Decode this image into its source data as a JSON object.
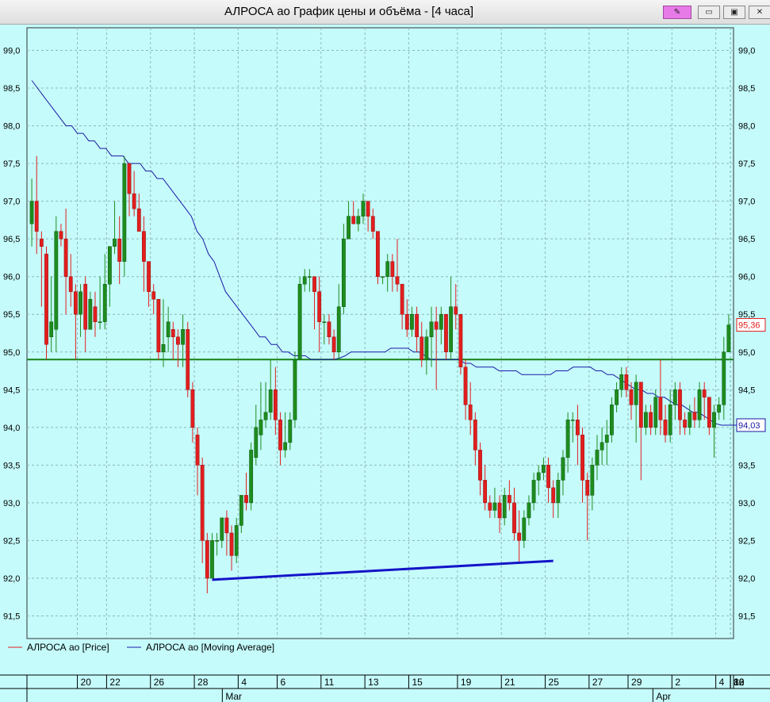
{
  "window": {
    "title": "АЛРОСА ао График цены и объёма - [4 часа]",
    "icons": {
      "pin": "pin-icon",
      "minimize": "minimize-icon",
      "restore": "restore-icon",
      "close": "close-icon"
    }
  },
  "chart_data": {
    "type": "candlestick",
    "title": "АЛРОСА ао График цены и объёма - [4 часа]",
    "ylim": [
      91.2,
      99.3
    ],
    "y_ticks": [
      "91,5",
      "92,0",
      "92,5",
      "93,0",
      "93,5",
      "94,0",
      "94,5",
      "95,0",
      "95,5",
      "96,0",
      "96,5",
      "97,0",
      "97,5",
      "98,0",
      "98,5",
      "99,0"
    ],
    "y_tick_values": [
      91.5,
      92.0,
      92.5,
      93.0,
      93.5,
      94.0,
      94.5,
      95.0,
      95.5,
      96.0,
      96.5,
      97.0,
      97.5,
      98.0,
      98.5,
      99.0
    ],
    "x_day_labels": [
      "20",
      "22",
      "26",
      "28",
      "4",
      "6",
      "11",
      "13",
      "15",
      "19",
      "21",
      "25",
      "27",
      "29",
      "2",
      "4",
      "8",
      "10",
      "12",
      "16"
    ],
    "x_month_labels": [
      "Mar",
      "Apr"
    ],
    "candles": [
      [
        96.7,
        97.0,
        96.4,
        97.3
      ],
      [
        97.0,
        96.6,
        96.3,
        97.6
      ],
      [
        96.5,
        96.4,
        95.6,
        96.6
      ],
      [
        96.3,
        95.1,
        94.9,
        96.4
      ],
      [
        95.2,
        95.4,
        95.0,
        96.0
      ],
      [
        95.3,
        96.6,
        95.0,
        96.8
      ],
      [
        96.6,
        96.5,
        96.4,
        96.7
      ],
      [
        96.5,
        96.0,
        95.5,
        96.9
      ],
      [
        96.0,
        95.8,
        95.6,
        96.3
      ],
      [
        95.8,
        95.5,
        94.9,
        95.9
      ],
      [
        95.5,
        95.8,
        95.2,
        95.9
      ],
      [
        95.9,
        95.3,
        95.0,
        96.0
      ],
      [
        95.3,
        95.7,
        95.3,
        95.8
      ],
      [
        95.6,
        95.4,
        95.2,
        95.8
      ],
      [
        95.4,
        95.4,
        95.3,
        96.0
      ],
      [
        95.4,
        95.9,
        95.3,
        96.3
      ],
      [
        95.9,
        96.4,
        95.6,
        96.4
      ],
      [
        96.4,
        96.5,
        96.3,
        97.0
      ],
      [
        96.5,
        96.2,
        95.9,
        96.8
      ],
      [
        96.2,
        97.5,
        96.0,
        97.6
      ],
      [
        97.5,
        97.1,
        96.8,
        97.5
      ],
      [
        97.1,
        96.9,
        96.8,
        97.4
      ],
      [
        96.9,
        96.6,
        96.6,
        97.1
      ],
      [
        96.6,
        96.2,
        95.8,
        96.8
      ],
      [
        96.2,
        95.8,
        95.6,
        96.2
      ],
      [
        95.8,
        95.7,
        95.5,
        95.9
      ],
      [
        95.7,
        95.0,
        94.9,
        95.7
      ],
      [
        95.0,
        95.1,
        94.8,
        95.7
      ],
      [
        95.2,
        95.4,
        95.0,
        95.6
      ],
      [
        95.3,
        95.2,
        94.9,
        95.4
      ],
      [
        95.2,
        95.1,
        94.8,
        95.3
      ],
      [
        95.1,
        95.3,
        94.8,
        95.5
      ],
      [
        95.3,
        94.5,
        94.4,
        95.4
      ],
      [
        94.5,
        94.0,
        93.8,
        94.6
      ],
      [
        93.9,
        93.5,
        93.1,
        94.0
      ],
      [
        93.5,
        92.5,
        92.2,
        93.6
      ],
      [
        92.5,
        92.0,
        91.8,
        92.6
      ],
      [
        92.0,
        92.5,
        92.1,
        92.6
      ],
      [
        92.5,
        92.5,
        92.3,
        92.6
      ],
      [
        92.5,
        92.8,
        92.4,
        92.8
      ],
      [
        92.8,
        92.6,
        92.3,
        92.9
      ],
      [
        92.6,
        92.3,
        92.1,
        92.7
      ],
      [
        92.3,
        92.7,
        92.2,
        92.8
      ],
      [
        92.7,
        93.1,
        92.6,
        93.1
      ],
      [
        93.1,
        93.0,
        92.9,
        93.4
      ],
      [
        93.0,
        93.7,
        92.9,
        93.8
      ],
      [
        93.6,
        94.0,
        93.5,
        94.3
      ],
      [
        93.9,
        94.1,
        93.7,
        94.6
      ],
      [
        94.1,
        94.2,
        94.0,
        94.6
      ],
      [
        94.2,
        94.5,
        94.1,
        94.9
      ],
      [
        94.5,
        94.1,
        93.9,
        94.8
      ],
      [
        94.1,
        93.7,
        93.5,
        94.2
      ],
      [
        93.7,
        93.8,
        93.6,
        94.2
      ],
      [
        93.8,
        94.1,
        93.7,
        94.2
      ],
      [
        94.1,
        94.9,
        94.0,
        95.0
      ],
      [
        94.9,
        95.9,
        94.9,
        96.0
      ],
      [
        95.9,
        96.0,
        95.8,
        96.1
      ],
      [
        96.0,
        96.0,
        95.8,
        96.1
      ],
      [
        96.0,
        95.8,
        95.3,
        96.0
      ],
      [
        95.8,
        95.4,
        95.0,
        96.0
      ],
      [
        95.4,
        95.4,
        95.1,
        95.5
      ],
      [
        95.4,
        95.2,
        95.1,
        95.5
      ],
      [
        95.2,
        95.0,
        94.9,
        95.3
      ],
      [
        95.0,
        95.6,
        94.9,
        95.9
      ],
      [
        95.6,
        96.5,
        95.5,
        96.7
      ],
      [
        96.5,
        96.8,
        96.6,
        97.0
      ],
      [
        96.8,
        96.7,
        96.7,
        97.0
      ],
      [
        96.7,
        96.8,
        96.6,
        96.9
      ],
      [
        96.8,
        97.0,
        96.7,
        97.1
      ],
      [
        97.0,
        96.8,
        96.6,
        97.0
      ],
      [
        96.8,
        96.6,
        96.5,
        96.9
      ],
      [
        96.6,
        96.0,
        95.9,
        96.6
      ],
      [
        96.0,
        96.0,
        95.9,
        96.0
      ],
      [
        96.0,
        96.2,
        95.8,
        96.3
      ],
      [
        96.2,
        96.0,
        95.8,
        96.3
      ],
      [
        96.0,
        95.9,
        95.8,
        96.5
      ],
      [
        95.9,
        95.5,
        95.3,
        95.9
      ],
      [
        95.5,
        95.3,
        95.2,
        95.7
      ],
      [
        95.3,
        95.5,
        95.2,
        95.6
      ],
      [
        95.5,
        95.2,
        95.0,
        95.6
      ],
      [
        95.2,
        94.9,
        94.8,
        95.4
      ],
      [
        94.9,
        95.2,
        94.7,
        95.3
      ],
      [
        95.2,
        95.4,
        94.8,
        95.6
      ],
      [
        95.4,
        95.3,
        94.5,
        95.6
      ],
      [
        95.3,
        95.5,
        95.1,
        95.6
      ],
      [
        95.5,
        95.0,
        94.9,
        95.5
      ],
      [
        95.0,
        95.6,
        94.9,
        96.0
      ],
      [
        95.6,
        95.5,
        95.3,
        95.9
      ],
      [
        95.5,
        94.8,
        94.7,
        95.5
      ],
      [
        94.8,
        94.3,
        94.1,
        94.9
      ],
      [
        94.3,
        94.1,
        93.9,
        94.6
      ],
      [
        94.1,
        93.7,
        93.5,
        94.2
      ],
      [
        93.7,
        93.3,
        93.1,
        93.8
      ],
      [
        93.3,
        93.0,
        92.9,
        93.5
      ],
      [
        93.0,
        92.9,
        92.8,
        93.1
      ],
      [
        92.9,
        93.0,
        92.8,
        93.2
      ],
      [
        93.0,
        92.8,
        92.6,
        93.1
      ],
      [
        92.8,
        93.1,
        92.7,
        93.2
      ],
      [
        93.1,
        93.0,
        92.9,
        93.3
      ],
      [
        93.0,
        92.6,
        92.5,
        93.2
      ],
      [
        92.6,
        92.5,
        92.2,
        92.9
      ],
      [
        92.5,
        92.8,
        92.4,
        92.9
      ],
      [
        92.8,
        93.0,
        92.7,
        93.1
      ],
      [
        93.0,
        93.3,
        92.9,
        93.4
      ],
      [
        93.3,
        93.4,
        93.1,
        93.5
      ],
      [
        93.4,
        93.5,
        93.3,
        93.6
      ],
      [
        93.5,
        93.2,
        93.0,
        93.6
      ],
      [
        93.2,
        93.0,
        92.8,
        93.3
      ],
      [
        93.0,
        93.3,
        92.8,
        93.4
      ],
      [
        93.3,
        93.6,
        93.1,
        93.7
      ],
      [
        93.6,
        94.1,
        93.4,
        94.2
      ],
      [
        94.1,
        94.1,
        93.8,
        94.2
      ],
      [
        94.1,
        93.9,
        93.5,
        94.3
      ],
      [
        93.9,
        93.3,
        93.0,
        94.0
      ],
      [
        93.3,
        93.1,
        92.5,
        93.4
      ],
      [
        93.1,
        93.5,
        92.9,
        93.6
      ],
      [
        93.5,
        93.7,
        93.3,
        93.9
      ],
      [
        93.7,
        93.8,
        93.5,
        94.0
      ],
      [
        93.8,
        93.9,
        93.5,
        94.1
      ],
      [
        93.9,
        94.3,
        93.8,
        94.4
      ],
      [
        94.3,
        94.5,
        94.2,
        94.6
      ],
      [
        94.5,
        94.7,
        94.4,
        94.8
      ],
      [
        94.7,
        94.5,
        94.4,
        94.8
      ],
      [
        94.5,
        94.3,
        94.1,
        94.6
      ],
      [
        94.3,
        94.6,
        93.8,
        94.7
      ],
      [
        94.6,
        94.0,
        93.3,
        94.6
      ],
      [
        94.0,
        94.2,
        93.9,
        94.3
      ],
      [
        94.2,
        94.0,
        93.9,
        94.3
      ],
      [
        94.0,
        94.4,
        93.9,
        94.5
      ],
      [
        94.4,
        94.1,
        93.9,
        94.9
      ],
      [
        94.1,
        93.9,
        93.8,
        94.3
      ],
      [
        93.9,
        94.3,
        93.8,
        94.5
      ],
      [
        94.3,
        94.5,
        94.1,
        94.6
      ],
      [
        94.5,
        94.1,
        93.9,
        94.6
      ],
      [
        94.1,
        94.0,
        93.9,
        94.2
      ],
      [
        94.0,
        94.2,
        93.9,
        94.3
      ],
      [
        94.2,
        94.1,
        94.0,
        94.4
      ],
      [
        94.1,
        94.5,
        94.0,
        94.6
      ],
      [
        94.5,
        94.4,
        94.1,
        94.6
      ],
      [
        94.4,
        94.0,
        93.9,
        94.4
      ],
      [
        94.0,
        94.2,
        93.6,
        94.3
      ],
      [
        94.2,
        94.3,
        94.1,
        94.4
      ],
      [
        94.3,
        95.0,
        94.1,
        95.2
      ],
      [
        95.0,
        95.36,
        95.0,
        95.5
      ]
    ],
    "moving_average": [
      98.6,
      98.5,
      98.4,
      98.3,
      98.2,
      98.1,
      98.0,
      98.0,
      97.9,
      97.9,
      97.8,
      97.8,
      97.7,
      97.7,
      97.6,
      97.6,
      97.6,
      97.5,
      97.5,
      97.5,
      97.4,
      97.4,
      97.3,
      97.3,
      97.2,
      97.1,
      97.0,
      96.9,
      96.8,
      96.6,
      96.5,
      96.3,
      96.2,
      96.0,
      95.8,
      95.7,
      95.6,
      95.5,
      95.4,
      95.3,
      95.2,
      95.2,
      95.1,
      95.1,
      95.0,
      95.0,
      94.95,
      94.95,
      94.95,
      94.9,
      94.9,
      94.9,
      94.9,
      94.9,
      94.92,
      94.95,
      95.0,
      95.0,
      95.0,
      95.0,
      95.0,
      95.0,
      95.0,
      95.05,
      95.05,
      95.05,
      95.05,
      95.0,
      95.0,
      94.95,
      94.9,
      94.9,
      94.9,
      94.9,
      94.9,
      94.9,
      94.85,
      94.85,
      94.8,
      94.8,
      94.8,
      94.8,
      94.75,
      94.75,
      94.75,
      94.75,
      94.7,
      94.7,
      94.7,
      94.7,
      94.7,
      94.7,
      94.75,
      94.75,
      94.75,
      94.8,
      94.8,
      94.8,
      94.8,
      94.75,
      94.75,
      94.7,
      94.7,
      94.65,
      94.6,
      94.55,
      94.5,
      94.5,
      94.45,
      94.45,
      94.4,
      94.4,
      94.35,
      94.3,
      94.3,
      94.25,
      94.2,
      94.2,
      94.15,
      94.1,
      94.05,
      94.03,
      94.03,
      94.03,
      94.03
    ],
    "horizontal_level": 94.9,
    "trendline": {
      "from": {
        "index": 37,
        "value": 91.98
      },
      "to": {
        "index": 107,
        "value": 92.23
      }
    },
    "last_price_label": "95,36",
    "ma_label": "94,03",
    "colors": {
      "background": "#c5fbfb",
      "grid": "#8fb8b8",
      "up": "#1e8c1e",
      "down": "#e21e1e",
      "wick": "#444444",
      "ma": "#1a1aa6",
      "level": "#168216",
      "trend": "#1414c8",
      "price_tag": "#e21e1e",
      "ma_tag": "#1a1aa6"
    },
    "legend": [
      {
        "name": "АЛРОСА ао [Price]",
        "color": "#e21e1e"
      },
      {
        "name": "АЛРОСА ао [Moving Average]",
        "color": "#1a1aa6"
      }
    ]
  }
}
